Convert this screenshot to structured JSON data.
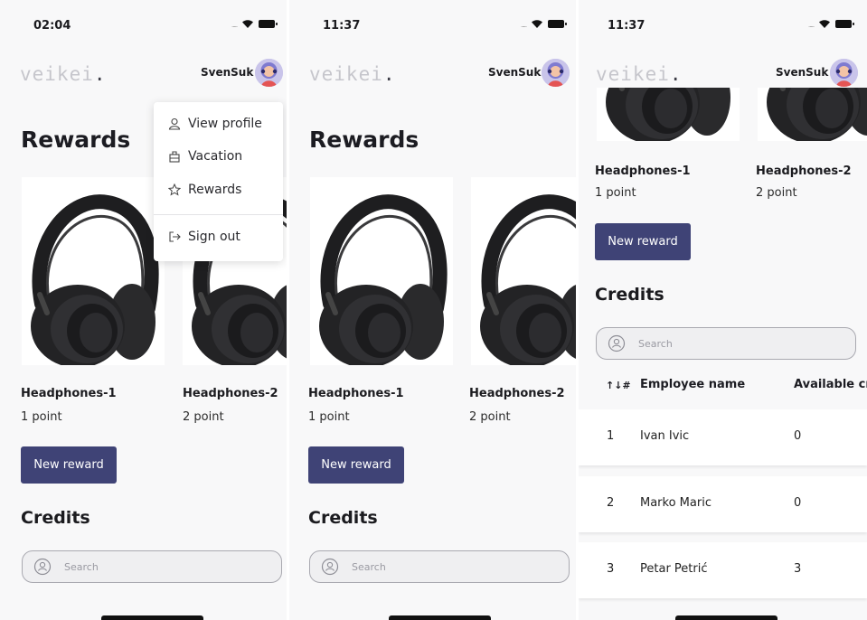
{
  "common": {
    "logo_text": "veikei",
    "logo_dot": ".",
    "username": "SvenSuk",
    "signal": "....."
  },
  "screens": [
    {
      "time": "02:04"
    },
    {
      "time": "11:37"
    },
    {
      "time": "11:37"
    }
  ],
  "rewards": {
    "title": "Rewards",
    "items": [
      {
        "name": "Headphones-1",
        "points": "1 point"
      },
      {
        "name": "Headphones-2",
        "points": "2 point"
      }
    ],
    "new_reward_label": "New reward"
  },
  "credits": {
    "title": "Credits",
    "search_placeholder": "Search",
    "columns": [
      "↑↓#",
      "Employee name",
      "Available cre"
    ],
    "rows": [
      {
        "index": "1",
        "name": "Ivan Ivic",
        "available": "0"
      },
      {
        "index": "2",
        "name": "Marko Maric",
        "available": "0"
      },
      {
        "index": "3",
        "name": "Petar Petrić",
        "available": "3"
      }
    ]
  },
  "menu": {
    "items": [
      {
        "label": "View profile",
        "icon": "user-icon"
      },
      {
        "label": "Vacation",
        "icon": "vacation-icon"
      },
      {
        "label": "Rewards",
        "icon": "star-icon"
      },
      {
        "label": "Sign out",
        "icon": "sign-out-icon"
      }
    ]
  },
  "colors": {
    "button": "#3f4376",
    "logo": "#c6c6cc",
    "background": "#f8f8f9"
  }
}
